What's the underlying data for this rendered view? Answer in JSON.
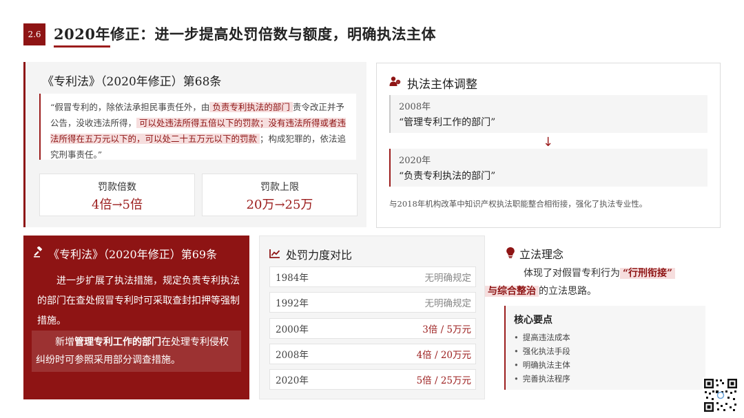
{
  "header": {
    "section_number": "2.6",
    "title": "2020年修正：进一步提高处罚倍数与额度，明确执法主体"
  },
  "article68": {
    "title": "《专利法》（2020年修正）第68条",
    "quote": {
      "p1": "“假冒专利的，除依法承担民事责任外，由",
      "h1": "负责专利执法的部门",
      "p2": "责令改正并予公告，没收违法所得，",
      "h2": "可以处违法所得五倍以下的罚款；没有违法所得或者违法所得在五万元以下的，可以处二十五万元以下的罚款",
      "p3": "；构成犯罪的，依法追究刑事责任。”"
    },
    "stats": [
      {
        "label": "罚款倍数",
        "value": "4倍→5倍"
      },
      {
        "label": "罚款上限",
        "value": "20万→25万"
      }
    ]
  },
  "subject": {
    "title": "执法主体调整",
    "old": {
      "year": "2008年",
      "text": "“管理专利工作的部门”"
    },
    "new": {
      "year": "2020年",
      "text": "“负责专利执法的部门”"
    },
    "note": "与2018年机构改革中知识产权执法职能整合相衔接，强化了执法专业性。"
  },
  "article69": {
    "title": "《专利法》（2020年修正）第69条",
    "body1": "进一步扩展了执法措施，规定负责专利执法的部门在查处假冒专利时可采取查封扣押等强制措施。",
    "body2_pre": "新增",
    "body2_bold": "管理专利工作的部门",
    "body2_post": "在处理专利侵权纠纷时可参照采用部分调查措施。"
  },
  "comparison": {
    "title": "处罚力度对比",
    "rows": [
      {
        "year": "1984年",
        "value": "无明确规定"
      },
      {
        "year": "1992年",
        "value": "无明确规定"
      },
      {
        "year": "2000年",
        "value": "3倍 / 5万元"
      },
      {
        "year": "2008年",
        "value": "4倍 / 20万元"
      },
      {
        "year": "2020年",
        "value": "5倍 / 25万元"
      }
    ]
  },
  "philosophy": {
    "title": "立法理念",
    "body_pre": "体现了对假冒专利行为",
    "body_hl1": "“行刑衔接”",
    "body_hl2": "与综合整治",
    "body_post": "的立法思路。",
    "key_title": "核心要点",
    "points": [
      "提高违法成本",
      "强化执法手段",
      "明确执法主体",
      "完善执法程序"
    ]
  },
  "colors": {
    "accent": "#8e1414",
    "highlight_bg": "#f6dede"
  },
  "icons": {
    "subject": "users-icon",
    "article69": "gavel-icon",
    "comparison": "chart-line-icon",
    "philosophy": "lightbulb-icon"
  }
}
